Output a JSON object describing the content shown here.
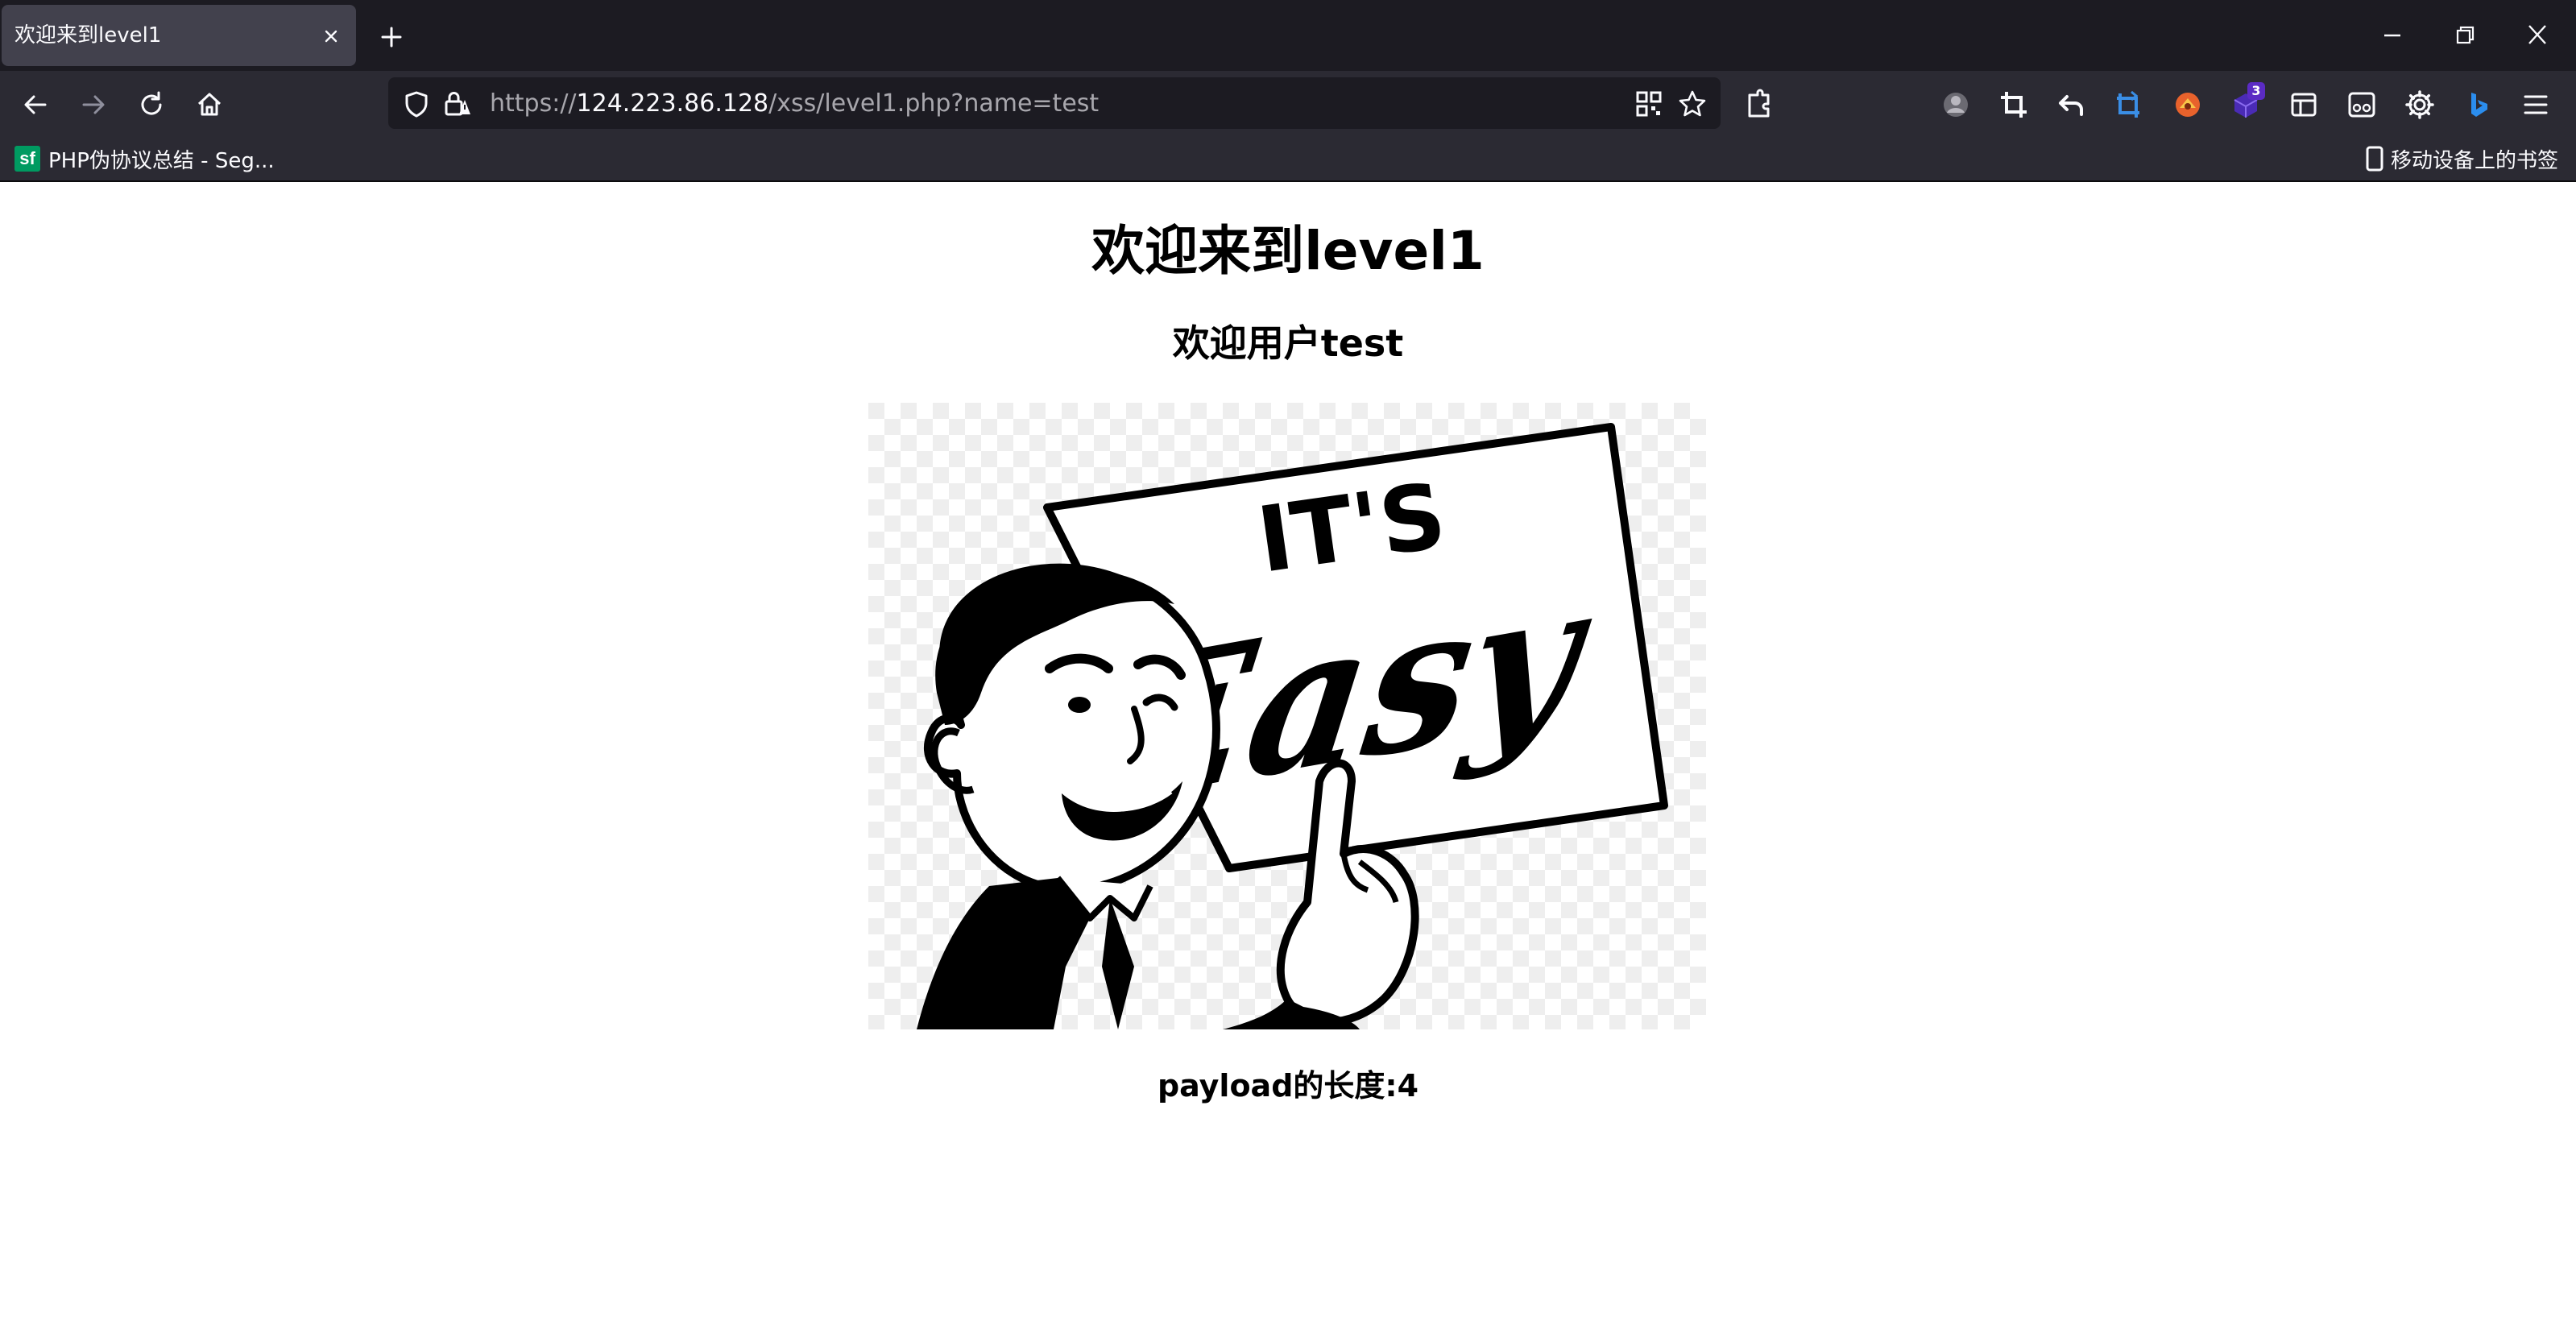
{
  "browser": {
    "tab": {
      "title": "欢迎来到level1"
    },
    "url": {
      "scheme": "https://",
      "host": "124.223.86.128",
      "path": "/xss/level1.php?name=test"
    },
    "extension_badge": "3",
    "bookmarks": {
      "items": [
        {
          "label": "PHP伪协议总结 - Seg...",
          "favicon_text": "sf",
          "favicon_color": "#009a61"
        }
      ],
      "mobile_label": "移动设备上的书签"
    }
  },
  "page": {
    "heading": "欢迎来到level1",
    "welcome": "欢迎用户test",
    "image": {
      "sign_top": "IT'S",
      "sign_main": "Easy"
    },
    "payload_length": "payload的长度:4"
  }
}
